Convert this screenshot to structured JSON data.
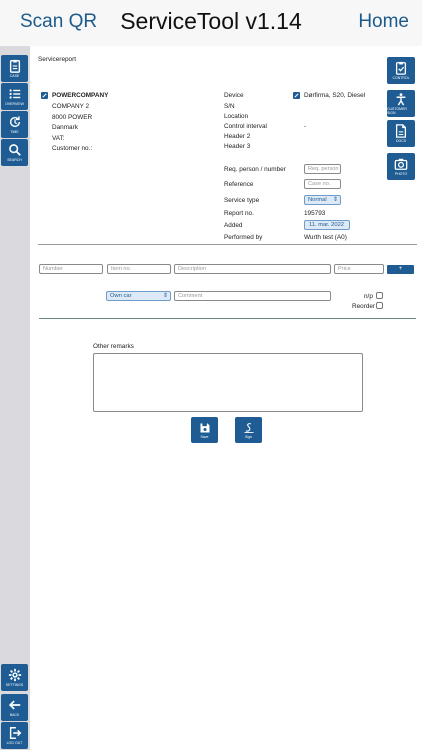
{
  "nav": {
    "left": "Scan QR",
    "title": "ServiceTool v1.14",
    "right": "Home"
  },
  "left_rail": {
    "case": "CASE",
    "overview": "OVERVIEW",
    "time": "TIME",
    "search": "SEARCH",
    "settings": "SETTINGS",
    "back": "BACK",
    "logout": "LOG OUT"
  },
  "right_rail": {
    "control": "Control",
    "customer_sign": "Customer sign",
    "docs": "Docs",
    "photo": "Photo"
  },
  "report": {
    "heading": "Servicereport",
    "customer": {
      "name": "POWERCOMPANY",
      "line2": "COMPANY 2",
      "line3": "8000 POWER",
      "country": "Danmark",
      "vat": "VAT:",
      "customer_no": "Customer no.:"
    },
    "device": {
      "label": "Device",
      "value": "Dørfirma, S20, Diesel",
      "sn_label": "S/N",
      "location_label": "Location",
      "interval_label": "Control interval",
      "interval_value": "-",
      "header2": "Header 2",
      "header3": "Header 3"
    },
    "req_person_label": "Req. person / number",
    "req_person_placeholder": "Req. person",
    "reference_label": "Reference",
    "reference_placeholder": "Case no.",
    "service_type_label": "Service type",
    "service_type_value": "Normal",
    "report_no_label": "Report no.",
    "report_no_value": "195793",
    "added_label": "Added",
    "added_value": "11. mar. 2022",
    "performed_by_label": "Performed by",
    "performed_by_value": "Wurth test (A0)"
  },
  "lines": {
    "number_placeholder": "Number",
    "item_placeholder": "Item no.",
    "description_placeholder": "Description",
    "price_placeholder": "Price",
    "add_label": "+",
    "car_value": "Own car",
    "comment_placeholder": "Comment",
    "np_label": "n/p",
    "reorder_label": "Reorder"
  },
  "remarks": {
    "label": "Other remarks"
  },
  "actions": {
    "save": "Save",
    "sign": "Sign"
  }
}
